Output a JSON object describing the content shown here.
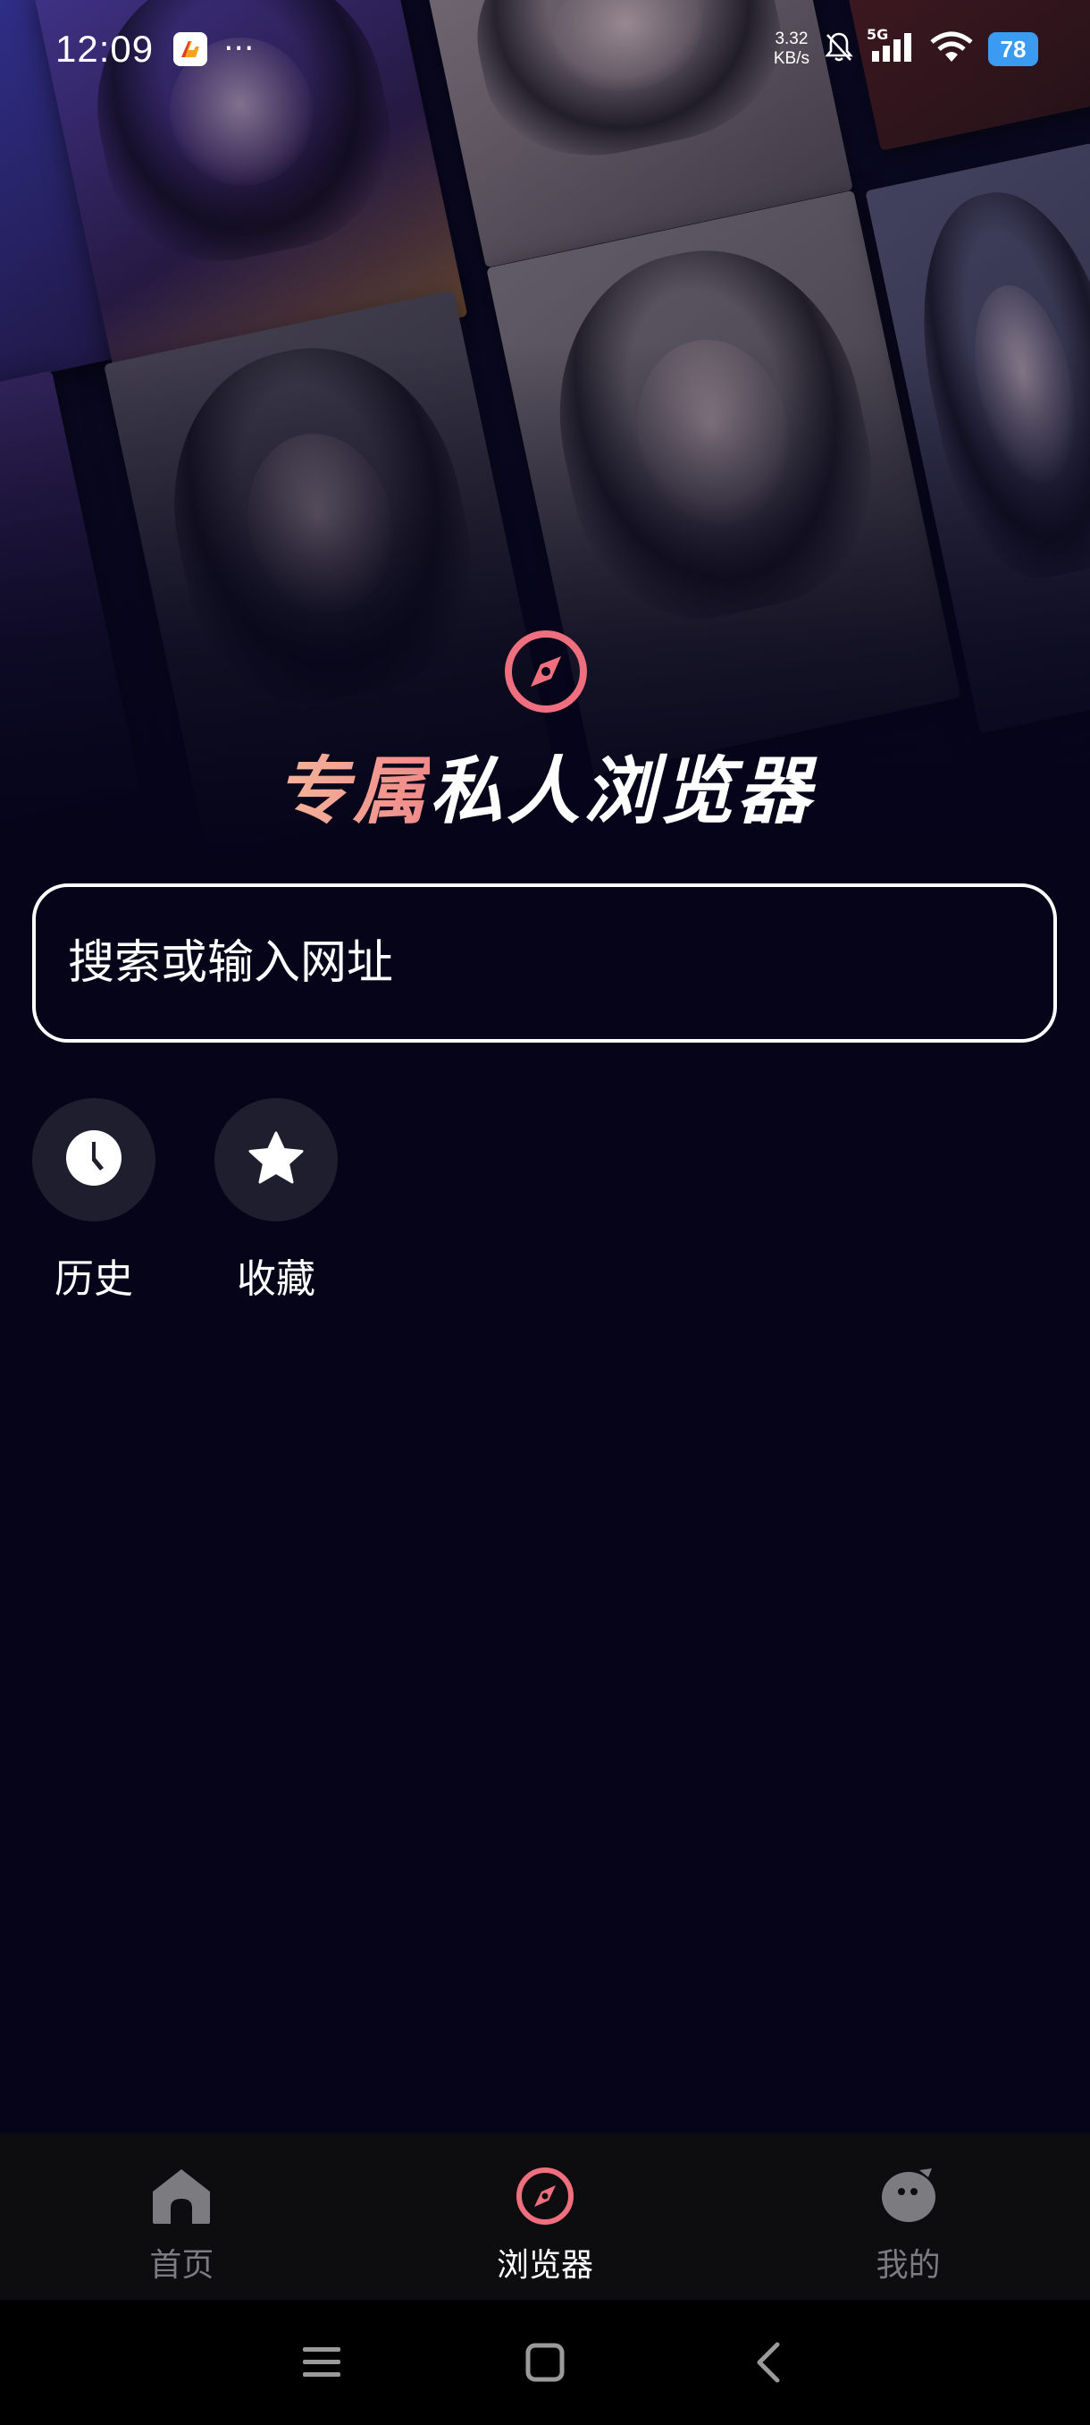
{
  "status_bar": {
    "time": "12:09",
    "net_speed_value": "3.32",
    "net_speed_unit": "KB/s",
    "network_type": "5G",
    "battery": "78",
    "more_indicator": "···"
  },
  "hero": {
    "logo_icon": "compass-icon",
    "title_accent": "专属",
    "title_rest": "私人浏览器",
    "title_accent_colors": [
      "#f6b59a",
      "#f08a8a"
    ]
  },
  "search": {
    "placeholder": "搜索或输入网址"
  },
  "quick_actions": [
    {
      "label": "历史",
      "icon": "clock-icon"
    },
    {
      "label": "收藏",
      "icon": "star-icon"
    }
  ],
  "bottom_nav": {
    "items": [
      {
        "label": "首页",
        "icon": "home-icon",
        "active": false
      },
      {
        "label": "浏览器",
        "icon": "compass-icon",
        "active": true
      },
      {
        "label": "我的",
        "icon": "profile-face-icon",
        "active": false
      }
    ],
    "active_color": "#ef6f7f",
    "inactive_color": "#7b7b80"
  },
  "system_nav": {
    "buttons": [
      "menu-icon",
      "home-square-icon",
      "back-icon"
    ]
  },
  "colors": {
    "background": "#050419",
    "accent": "#ef6f7f",
    "quick_circle": "#1f1e2e",
    "battery": "#3a9bf0"
  }
}
